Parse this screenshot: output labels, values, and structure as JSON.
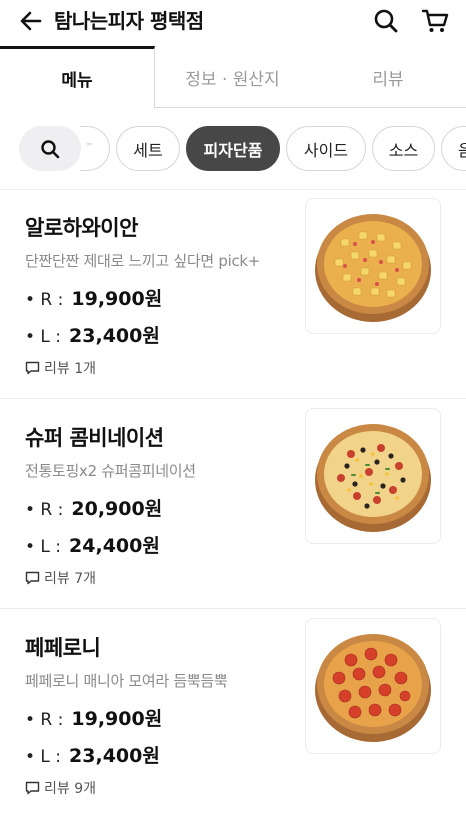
{
  "header": {
    "title": "탐나는피자 평택점",
    "back_icon": "arrow-left-icon",
    "search_icon": "search-icon",
    "cart_icon": "cart-icon"
  },
  "tabs": [
    {
      "label": "메뉴",
      "active": true
    },
    {
      "label": "정보 · 원산지",
      "active": false
    },
    {
      "label": "리뷰",
      "active": false
    }
  ],
  "categories": {
    "peek": "⁼",
    "items": [
      {
        "label": "세트",
        "selected": false
      },
      {
        "label": "피자단품",
        "selected": true
      },
      {
        "label": "사이드",
        "selected": false
      },
      {
        "label": "소스",
        "selected": false
      },
      {
        "label": "음",
        "selected": false
      }
    ]
  },
  "menu": [
    {
      "name": "알로하와이안",
      "desc": "단짠단짠 제대로 느끼고 싶다면 pick+",
      "prices": [
        {
          "size": "• R :",
          "price": "19,900원"
        },
        {
          "size": "• L :",
          "price": "23,400원"
        }
      ],
      "review": "리뷰 1개",
      "image": "hawaiian-pizza"
    },
    {
      "name": "슈퍼 콤비네이션",
      "desc": "전통토핑x2 슈퍼콤피네이션",
      "prices": [
        {
          "size": "• R :",
          "price": "20,900원"
        },
        {
          "size": "• L :",
          "price": "24,400원"
        }
      ],
      "review": "리뷰 7개",
      "image": "combination-pizza"
    },
    {
      "name": "페페로니",
      "desc": "페페로니 매니아 모여라 듬뿍듬뿍",
      "prices": [
        {
          "size": "• R :",
          "price": "19,900원"
        },
        {
          "size": "• L :",
          "price": "23,400원"
        }
      ],
      "review": "리뷰 9개",
      "image": "pepperoni-pizza"
    }
  ],
  "colors": {
    "selected_chip": "#474747",
    "inactive_tab": "#9a9a9a",
    "desc_text": "#8a8a8a"
  }
}
